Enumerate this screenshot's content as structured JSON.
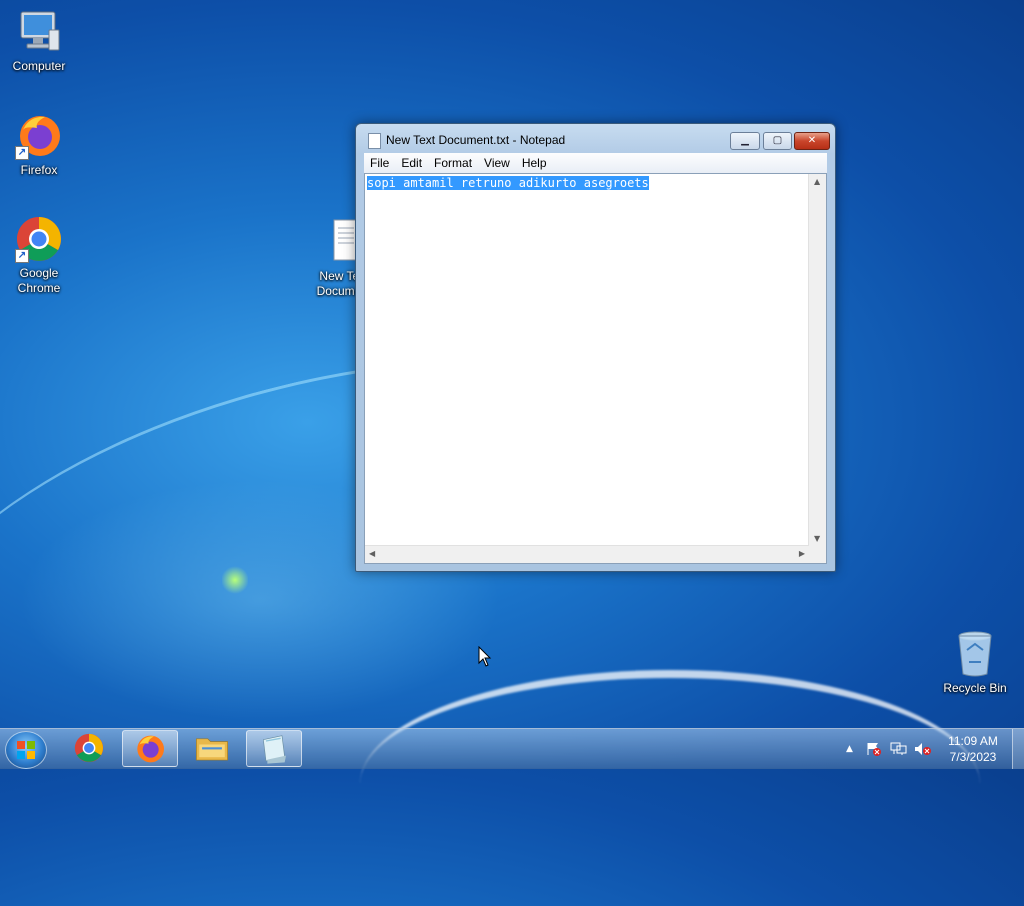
{
  "desktop": {
    "icons": [
      {
        "label": "Computer",
        "icon": "computer-icon"
      },
      {
        "label": "Firefox",
        "icon": "firefox-icon"
      },
      {
        "label": "Google Chrome",
        "icon": "chrome-icon"
      },
      {
        "label": "New Text Document",
        "icon": "text-file-icon"
      },
      {
        "label": "Recycle Bin",
        "icon": "recycle-bin-icon"
      }
    ]
  },
  "notepad": {
    "title": "New Text Document.txt - Notepad",
    "menu": [
      "File",
      "Edit",
      "Format",
      "View",
      "Help"
    ],
    "content": "sopi amtamil retruno adikurto asegroets",
    "buttons": {
      "minimize": "minimize-icon",
      "maximize": "maximize-icon",
      "close": "close-icon"
    }
  },
  "taskbar": {
    "items": [
      "start-orb",
      "chrome-icon",
      "firefox-icon",
      "file-explorer-icon",
      "notepad-icon"
    ],
    "tray": {
      "time": "11:09 AM",
      "date": "7/3/2023",
      "icons": [
        "show-hidden-icons-arrow",
        "action-center-icon",
        "network-icon",
        "volume-muted-icon"
      ]
    }
  },
  "colors": {
    "selection": "#3399ff",
    "close_button": "#c9452b"
  }
}
